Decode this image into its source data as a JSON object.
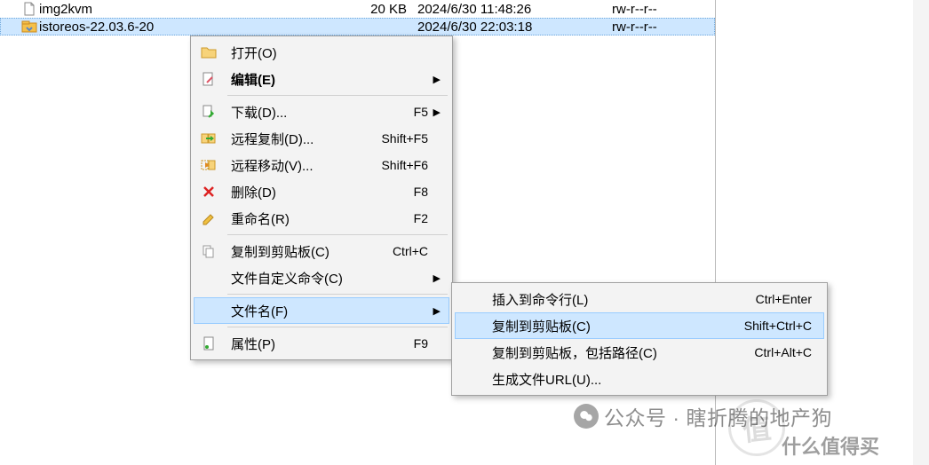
{
  "files": [
    {
      "name": "img2kvm",
      "size": "20 KB",
      "date": "2024/6/30 11:48:26",
      "perm": "rw-r--r--"
    },
    {
      "name": "istoreos-22.03.6-20",
      "size": "",
      "date": "2024/6/30 22:03:18",
      "perm": "rw-r--r--"
    }
  ],
  "menu": {
    "open": {
      "label": "打开(O)",
      "shortcut": ""
    },
    "edit": {
      "label": "编辑(E)",
      "shortcut": ""
    },
    "download": {
      "label": "下载(D)...",
      "shortcut": "F5"
    },
    "remote_copy": {
      "label": "远程复制(D)...",
      "shortcut": "Shift+F5"
    },
    "remote_move": {
      "label": "远程移动(V)...",
      "shortcut": "Shift+F6"
    },
    "delete": {
      "label": "删除(D)",
      "shortcut": "F8"
    },
    "rename": {
      "label": "重命名(R)",
      "shortcut": "F2"
    },
    "copy_clip": {
      "label": "复制到剪贴板(C)",
      "shortcut": "Ctrl+C"
    },
    "custom_cmd": {
      "label": "文件自定义命令(C)",
      "shortcut": ""
    },
    "filename": {
      "label": "文件名(F)",
      "shortcut": ""
    },
    "properties": {
      "label": "属性(P)",
      "shortcut": "F9"
    }
  },
  "submenu": {
    "insert_cmd": {
      "label": "插入到命令行(L)",
      "shortcut": "Ctrl+Enter"
    },
    "copy_clip": {
      "label": "复制到剪贴板(C)",
      "shortcut": "Shift+Ctrl+C"
    },
    "copy_path": {
      "label": "复制到剪贴板，包括路径(C)",
      "shortcut": "Ctrl+Alt+C"
    },
    "gen_url": {
      "label": "生成文件URL(U)...",
      "shortcut": ""
    }
  },
  "watermark": {
    "line1": "公众号 · 瞎折腾的地产狗",
    "line2": "什么值得买",
    "seal": "值"
  }
}
